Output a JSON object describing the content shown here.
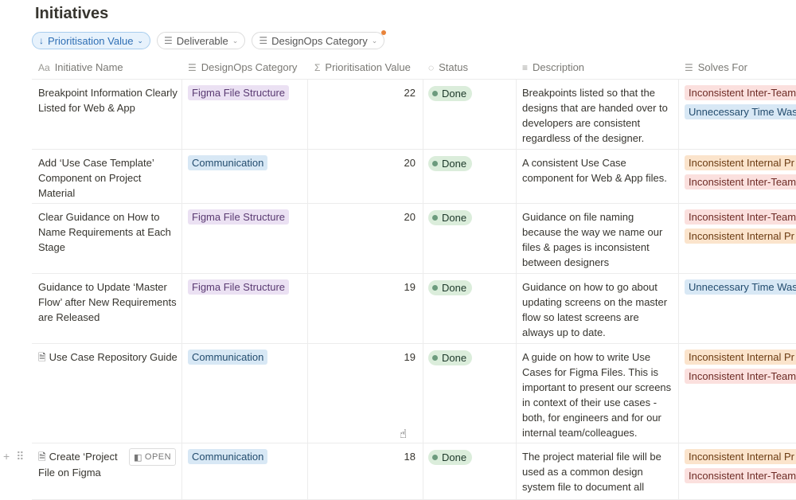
{
  "page": {
    "title": "Initiatives"
  },
  "filters": [
    {
      "label": "Prioritisation Value",
      "icon": "sort-down-icon",
      "active": true
    },
    {
      "label": "Deliverable",
      "icon": "list-icon",
      "active": false
    },
    {
      "label": "DesignOps Category",
      "icon": "list-icon",
      "active": false,
      "has_indicator": true
    }
  ],
  "columns": [
    {
      "label": "Initiative Name",
      "icon": "Aa"
    },
    {
      "label": "DesignOps Category",
      "icon": "list-icon"
    },
    {
      "label": "Prioritisation Value",
      "icon": "sigma-icon"
    },
    {
      "label": "Status",
      "icon": "status-icon"
    },
    {
      "label": "Description",
      "icon": "text-icon"
    },
    {
      "label": "Solves For",
      "icon": "list-icon"
    }
  ],
  "rows": [
    {
      "name": "Breakpoint Information Clearly Listed for Web & App",
      "category": "Figma File Structure",
      "value": "22",
      "status": "Done",
      "description": "Breakpoints listed so that the designs that are handed over to developers are consistent regardless of the designer.",
      "solves": [
        "Inconsistent Inter-Team",
        "Unnecessary Time Was"
      ]
    },
    {
      "name": "Add ‘Use Case Template’ Component on Project Material",
      "category": "Communication",
      "value": "20",
      "status": "Done",
      "description": "A consistent Use Case component for Web & App files.",
      "solves": [
        "Inconsistent Internal Pr",
        "Inconsistent Inter-Team"
      ]
    },
    {
      "name": "Clear Guidance on How to Name Requirements at Each Stage",
      "category": "Figma File Structure",
      "value": "20",
      "status": "Done",
      "description": "Guidance on file naming because the way we name our files & pages is inconsistent between designers",
      "solves": [
        "Inconsistent Inter-Team",
        "Inconsistent Internal Pr"
      ]
    },
    {
      "name": "Guidance to Update ‘Master Flow’ after New Requirements are Released",
      "category": "Figma File Structure",
      "value": "19",
      "status": "Done",
      "description": "Guidance on how to go about updating screens on the master flow so latest screens are always up to date.",
      "solves": [
        "Unnecessary Time Was"
      ]
    },
    {
      "name": "Use Case Repository Guide",
      "category": "Communication",
      "value": "19",
      "status": "Done",
      "description": "A guide on how to write Use Cases for Figma Files. This is important to present our screens in context of their use cases - both, for engineers and for our internal team/colleagues.",
      "solves": [
        "Inconsistent Internal Pr",
        "Inconsistent Inter-Team"
      ]
    },
    {
      "name": "Create ‘Project File on Figma",
      "category": "Communication",
      "value": "18",
      "status": "Done",
      "description": "The project material file will be used as a common design system file to document all",
      "solves": [
        "Inconsistent Internal Pr",
        "Inconsistent Inter-Team"
      ],
      "open_label": "OPEN"
    }
  ]
}
